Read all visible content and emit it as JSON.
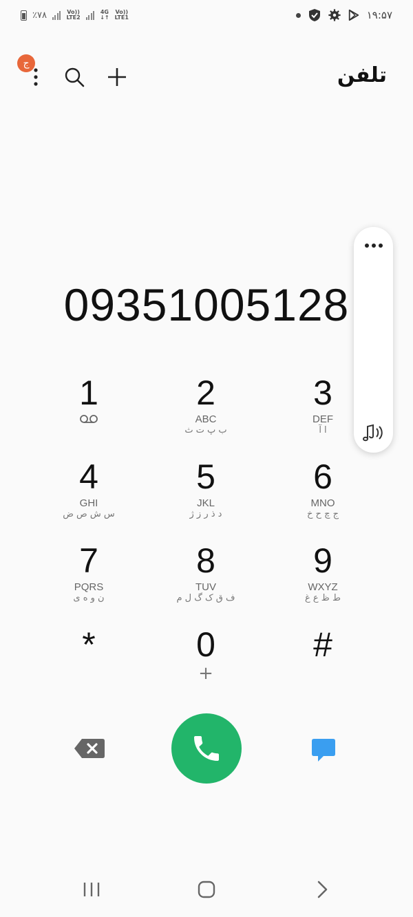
{
  "status_bar": {
    "battery": "٪۷۸",
    "sim1_net": "Vo)) LTE2",
    "sim2_net_top": "4G",
    "sim2_net_vol": "Vo)) LTE1",
    "time": "۱۹:۵۷"
  },
  "app_bar": {
    "title": "تلفن",
    "profile_badge": "ج",
    "icons": [
      "more-vert-icon",
      "search-icon",
      "add-icon"
    ]
  },
  "dialer": {
    "number": "09351005128"
  },
  "keypad": [
    {
      "digit": "1",
      "letters": "",
      "fa": "",
      "extra": "voicemail-icon"
    },
    {
      "digit": "2",
      "letters": "ABC",
      "fa": "ب پ ت ث"
    },
    {
      "digit": "3",
      "letters": "DEF",
      "fa": "ا آ"
    },
    {
      "digit": "4",
      "letters": "GHI",
      "fa": "س ش ص ض"
    },
    {
      "digit": "5",
      "letters": "JKL",
      "fa": "د ذ ر ز ژ"
    },
    {
      "digit": "6",
      "letters": "MNO",
      "fa": "ج چ ح خ"
    },
    {
      "digit": "7",
      "letters": "PQRS",
      "fa": "ن و ه ی"
    },
    {
      "digit": "8",
      "letters": "TUV",
      "fa": "ف ق ک گ ل م"
    },
    {
      "digit": "9",
      "letters": "WXYZ",
      "fa": "ط ظ ع غ"
    },
    {
      "digit": "*",
      "letters": "",
      "fa": ""
    },
    {
      "digit": "0",
      "letters": "+",
      "fa": ""
    },
    {
      "digit": "#",
      "letters": "",
      "fa": ""
    }
  ],
  "colors": {
    "call_green": "#22b56a",
    "badge_orange": "#e8673a",
    "message_blue": "#3a9ef0"
  },
  "nav_bar": {
    "icons": [
      "recent-apps-icon",
      "home-icon",
      "back-icon"
    ]
  }
}
